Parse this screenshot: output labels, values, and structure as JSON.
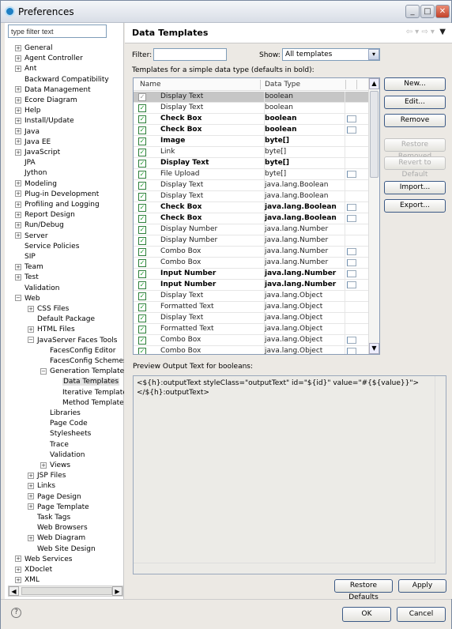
{
  "window": {
    "title": "Preferences"
  },
  "sidebar": {
    "filter_placeholder": "type filter text",
    "items": [
      {
        "label": "General",
        "level": 0,
        "exp": "+"
      },
      {
        "label": "Agent Controller",
        "level": 0,
        "exp": "+"
      },
      {
        "label": "Ant",
        "level": 0,
        "exp": "+"
      },
      {
        "label": "Backward Compatibility",
        "level": 0,
        "exp": ""
      },
      {
        "label": "Data Management",
        "level": 0,
        "exp": "+"
      },
      {
        "label": "Ecore Diagram",
        "level": 0,
        "exp": "+"
      },
      {
        "label": "Help",
        "level": 0,
        "exp": "+"
      },
      {
        "label": "Install/Update",
        "level": 0,
        "exp": "+"
      },
      {
        "label": "Java",
        "level": 0,
        "exp": "+"
      },
      {
        "label": "Java EE",
        "level": 0,
        "exp": "+"
      },
      {
        "label": "JavaScript",
        "level": 0,
        "exp": "+"
      },
      {
        "label": "JPA",
        "level": 0,
        "exp": ""
      },
      {
        "label": "Jython",
        "level": 0,
        "exp": ""
      },
      {
        "label": "Modeling",
        "level": 0,
        "exp": "+"
      },
      {
        "label": "Plug-in Development",
        "level": 0,
        "exp": "+"
      },
      {
        "label": "Profiling and Logging",
        "level": 0,
        "exp": "+"
      },
      {
        "label": "Report Design",
        "level": 0,
        "exp": "+"
      },
      {
        "label": "Run/Debug",
        "level": 0,
        "exp": "+"
      },
      {
        "label": "Server",
        "level": 0,
        "exp": "+"
      },
      {
        "label": "Service Policies",
        "level": 0,
        "exp": ""
      },
      {
        "label": "SIP",
        "level": 0,
        "exp": ""
      },
      {
        "label": "Team",
        "level": 0,
        "exp": "+"
      },
      {
        "label": "Test",
        "level": 0,
        "exp": "+"
      },
      {
        "label": "Validation",
        "level": 0,
        "exp": ""
      },
      {
        "label": "Web",
        "level": 0,
        "exp": "-"
      },
      {
        "label": "CSS Files",
        "level": 1,
        "exp": "+"
      },
      {
        "label": "Default Package",
        "level": 1,
        "exp": ""
      },
      {
        "label": "HTML Files",
        "level": 1,
        "exp": "+"
      },
      {
        "label": "JavaServer Faces Tools",
        "level": 1,
        "exp": "-"
      },
      {
        "label": "FacesConfig Editor",
        "level": 2,
        "exp": ""
      },
      {
        "label": "FacesConfig Schemes",
        "level": 2,
        "exp": ""
      },
      {
        "label": "Generation Templates",
        "level": 2,
        "exp": "-"
      },
      {
        "label": "Data Templates",
        "level": 3,
        "exp": "",
        "selected": true
      },
      {
        "label": "Iterative Templates",
        "level": 3,
        "exp": ""
      },
      {
        "label": "Method Templates",
        "level": 3,
        "exp": ""
      },
      {
        "label": "Libraries",
        "level": 2,
        "exp": ""
      },
      {
        "label": "Page Code",
        "level": 2,
        "exp": ""
      },
      {
        "label": "Stylesheets",
        "level": 2,
        "exp": ""
      },
      {
        "label": "Trace",
        "level": 2,
        "exp": ""
      },
      {
        "label": "Validation",
        "level": 2,
        "exp": ""
      },
      {
        "label": "Views",
        "level": 2,
        "exp": "+"
      },
      {
        "label": "JSP Files",
        "level": 1,
        "exp": "+"
      },
      {
        "label": "Links",
        "level": 1,
        "exp": "+"
      },
      {
        "label": "Page Design",
        "level": 1,
        "exp": "+"
      },
      {
        "label": "Page Template",
        "level": 1,
        "exp": "+"
      },
      {
        "label": "Task Tags",
        "level": 1,
        "exp": ""
      },
      {
        "label": "Web Browsers",
        "level": 1,
        "exp": ""
      },
      {
        "label": "Web Diagram",
        "level": 1,
        "exp": "+"
      },
      {
        "label": "Web Site Design",
        "level": 1,
        "exp": ""
      },
      {
        "label": "Web Services",
        "level": 0,
        "exp": "+"
      },
      {
        "label": "XDoclet",
        "level": 0,
        "exp": "+"
      },
      {
        "label": "XML",
        "level": 0,
        "exp": "+"
      }
    ]
  },
  "main": {
    "title": "Data Templates",
    "filter_label": "Filter:",
    "filter_value": "",
    "show_label": "Show:",
    "show_value": "All templates",
    "table_caption": "Templates for a simple data type (defaults in bold):",
    "columns": [
      "Name",
      "Data Type"
    ],
    "rows": [
      {
        "name": "Display Text",
        "type": "boolean",
        "bold": false,
        "icon": false,
        "checked": true
      },
      {
        "name": "Display Text",
        "type": "boolean",
        "bold": false,
        "icon": false,
        "checked": true
      },
      {
        "name": "Check Box",
        "type": "boolean",
        "bold": true,
        "icon": true,
        "checked": true
      },
      {
        "name": "Check Box",
        "type": "boolean",
        "bold": true,
        "icon": true,
        "checked": true
      },
      {
        "name": "Image",
        "type": "byte[]",
        "bold": true,
        "icon": false,
        "checked": true
      },
      {
        "name": "Link",
        "type": "byte[]",
        "bold": false,
        "icon": false,
        "checked": true
      },
      {
        "name": "Display Text",
        "type": "byte[]",
        "bold": true,
        "icon": false,
        "checked": true
      },
      {
        "name": "File Upload",
        "type": "byte[]",
        "bold": false,
        "icon": true,
        "checked": true
      },
      {
        "name": "Display Text",
        "type": "java.lang.Boolean",
        "bold": false,
        "icon": false,
        "checked": true
      },
      {
        "name": "Display Text",
        "type": "java.lang.Boolean",
        "bold": false,
        "icon": false,
        "checked": true
      },
      {
        "name": "Check Box",
        "type": "java.lang.Boolean",
        "bold": true,
        "icon": true,
        "checked": true
      },
      {
        "name": "Check Box",
        "type": "java.lang.Boolean",
        "bold": true,
        "icon": true,
        "checked": true
      },
      {
        "name": "Display Number",
        "type": "java.lang.Number",
        "bold": false,
        "icon": false,
        "checked": true
      },
      {
        "name": "Display Number",
        "type": "java.lang.Number",
        "bold": false,
        "icon": false,
        "checked": true
      },
      {
        "name": "Combo Box",
        "type": "java.lang.Number",
        "bold": false,
        "icon": true,
        "checked": true
      },
      {
        "name": "Combo Box",
        "type": "java.lang.Number",
        "bold": false,
        "icon": true,
        "checked": true
      },
      {
        "name": "Input Number",
        "type": "java.lang.Number",
        "bold": true,
        "icon": true,
        "checked": true
      },
      {
        "name": "Input Number",
        "type": "java.lang.Number",
        "bold": true,
        "icon": true,
        "checked": true
      },
      {
        "name": "Display Text",
        "type": "java.lang.Object",
        "bold": false,
        "icon": false,
        "checked": true
      },
      {
        "name": "Formatted Text",
        "type": "java.lang.Object",
        "bold": false,
        "icon": false,
        "checked": true
      },
      {
        "name": "Display Text",
        "type": "java.lang.Object",
        "bold": false,
        "icon": false,
        "checked": true
      },
      {
        "name": "Formatted Text",
        "type": "java.lang.Object",
        "bold": false,
        "icon": false,
        "checked": true
      },
      {
        "name": "Combo Box",
        "type": "java.lang.Object",
        "bold": false,
        "icon": true,
        "checked": true
      },
      {
        "name": "Combo Box",
        "type": "java.lang.Object",
        "bold": false,
        "icon": true,
        "checked": true
      }
    ],
    "buttons": {
      "new": "New...",
      "edit": "Edit...",
      "remove": "Remove",
      "restore_removed": "Restore Removed",
      "revert": "Revert to Default",
      "import": "Import...",
      "export": "Export..."
    },
    "preview_label": "Preview Output Text for booleans:",
    "preview_text": "<${h}:outputText styleClass=\"outputText\" id=\"${id}\" value=\"#{${value}}\">\n</${h}:outputText>",
    "restore_defaults": "Restore Defaults",
    "apply": "Apply"
  },
  "footer": {
    "ok": "OK",
    "cancel": "Cancel"
  }
}
